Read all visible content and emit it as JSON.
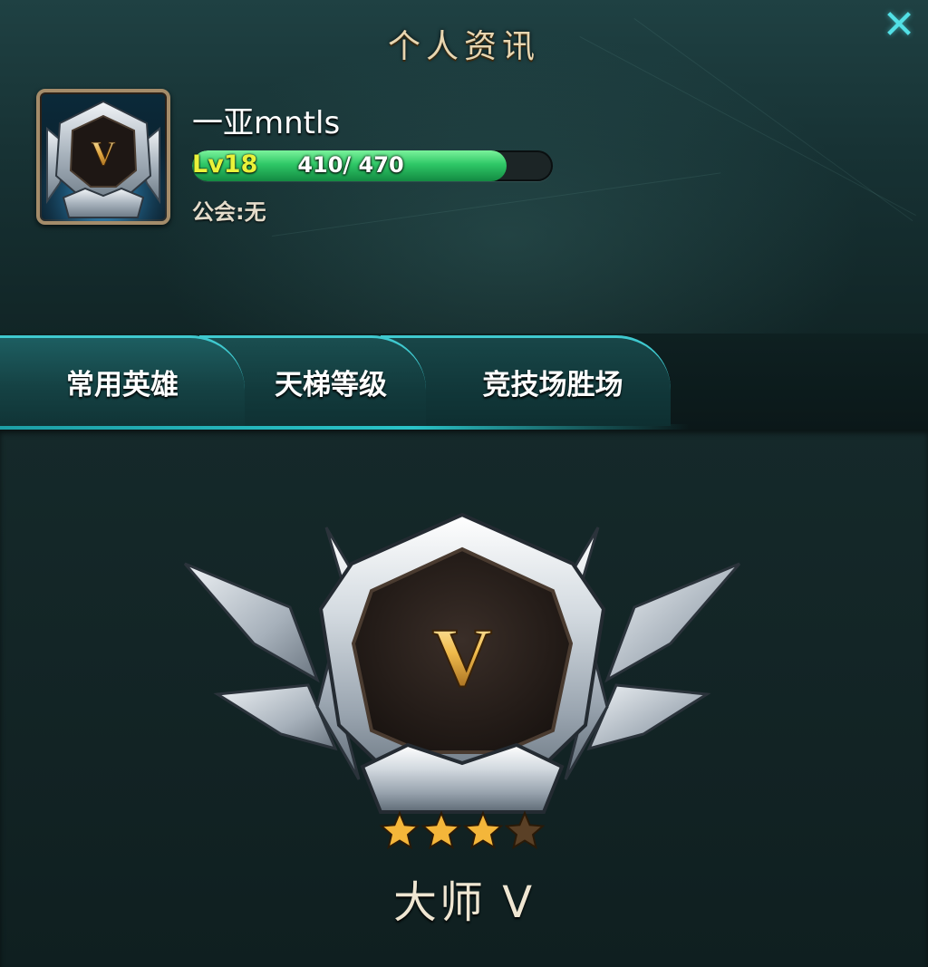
{
  "window": {
    "title": "个人资讯",
    "close_icon": "close-icon"
  },
  "player": {
    "name": "一亚mntls",
    "level_label": "Lv18",
    "exp_current": 410,
    "exp_max": 470,
    "exp_text": "410/ 470",
    "guild_text": "公会:无",
    "avatar_glyph": "V"
  },
  "tabs": [
    {
      "label": "常用英雄",
      "active": false
    },
    {
      "label": "天梯等级",
      "active": true
    },
    {
      "label": "竞技场胜场",
      "active": false
    }
  ],
  "rank": {
    "emblem_glyph": "V",
    "name": "大师 V",
    "stars_filled": 3,
    "stars_total": 4
  },
  "colors": {
    "accent_cyan": "#3fc9cf",
    "exp_green": "#2ec766",
    "level_yellow": "#e9f23a",
    "title_gold": "#e8d6b0",
    "star_gold": "#f4b63a",
    "star_empty": "#5a4026"
  }
}
